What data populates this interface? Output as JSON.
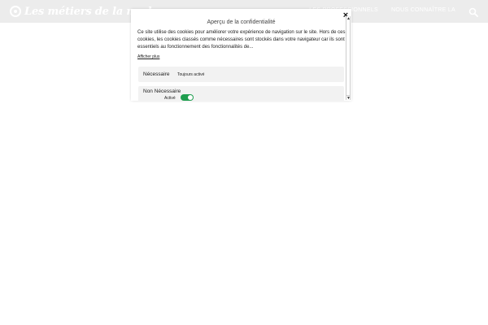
{
  "header": {
    "logo_text": "Les métiers de la mode",
    "nav": [
      "LES PROFESSIONNELS",
      "NOUS CONNAÎTRE LA"
    ]
  },
  "modal": {
    "title": "Aperçu de la confidentialité",
    "close_glyph": "×",
    "description": "Ce site utilise des cookies pour améliorer votre expérience de navigation sur le site. Hors de ces cookies, les cookies classés comme nécessaires sont stockés dans votre navigateur car ils sont essentiels au fonctionnement des fonctionnalités de...",
    "show_more": "Afficher plus",
    "categories": [
      {
        "name": "Nécessaire",
        "status": "Toujours activé"
      },
      {
        "name": "Non Nécessaire",
        "status": "Activé",
        "enabled": true
      }
    ]
  },
  "colors": {
    "header_bg": "#ececec",
    "toggle_on": "#1f9e4f",
    "row_bg": "#f2f2f2"
  },
  "icons": [
    "search-icon",
    "close-icon",
    "scroll-up-icon",
    "scroll-down-icon"
  ]
}
